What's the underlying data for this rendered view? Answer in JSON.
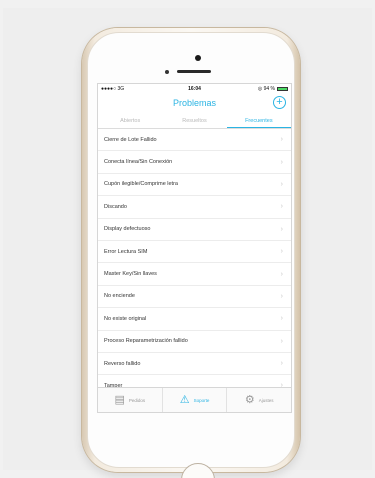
{
  "status_bar": {
    "carrier": "●●●●○ 3G",
    "time": "16:04",
    "battery": "◎ 94 %"
  },
  "nav": {
    "title": "Problemas",
    "add_icon": "plus-circle-icon",
    "add_label": "+"
  },
  "segments": [
    {
      "label": "Abiertos"
    },
    {
      "label": "Resueltos"
    },
    {
      "label": "Frecuentes"
    }
  ],
  "active_segment": "Frecuentes",
  "list": {
    "items": [
      {
        "label": "Cierre de Lote Fallido"
      },
      {
        "label": "Conecta línea/Sin Conexión"
      },
      {
        "label": "Cupón ilegible/Comprime letra"
      },
      {
        "label": "Discando"
      },
      {
        "label": "Display defectuoso"
      },
      {
        "label": "Error Lectura SIM"
      },
      {
        "label": "Master Key/Sin llaves"
      },
      {
        "label": "No enciende"
      },
      {
        "label": "No existe original"
      },
      {
        "label": "Proceso Reparametrización fallido"
      },
      {
        "label": "Reverso fallido"
      },
      {
        "label": "Tamper"
      }
    ],
    "chevron": "›"
  },
  "tab_bar": {
    "tabs": [
      {
        "label": "Pedidos",
        "icon": "clipboard-icon",
        "glyph": "▤"
      },
      {
        "label": "Soporte",
        "icon": "warning-icon",
        "glyph": "⚠"
      },
      {
        "label": "Ajustes",
        "icon": "gear-icon",
        "glyph": "⚙"
      }
    ],
    "active": "Soporte"
  },
  "colors": {
    "accent": "#2bb4e3",
    "phone_gold": "#f3ebdf"
  }
}
